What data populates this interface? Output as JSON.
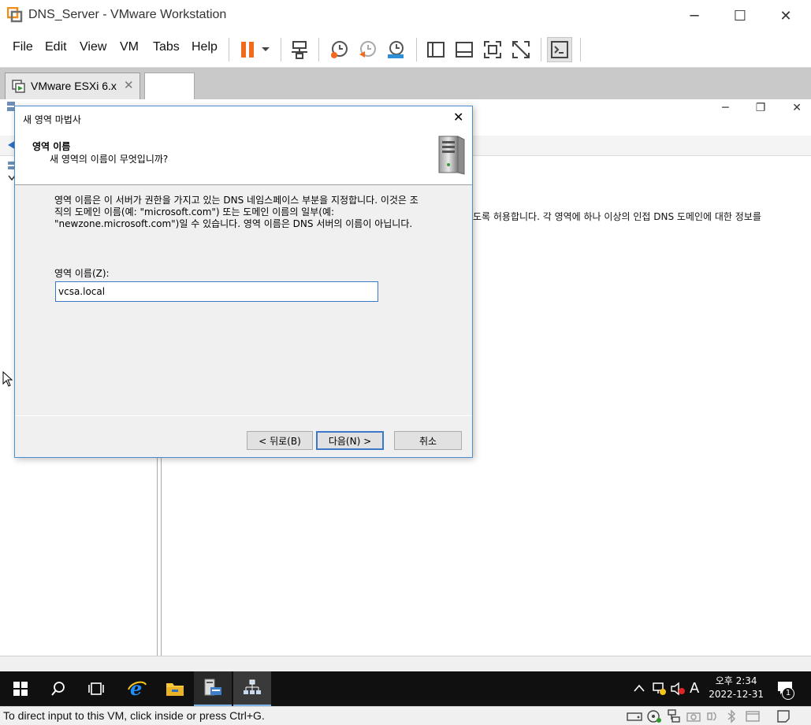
{
  "window": {
    "title": "DNS_Server - VMware Workstation",
    "min_glyph": "─",
    "max_glyph": "☐",
    "close_glyph": "✕"
  },
  "menu": {
    "items": [
      "File",
      "Edit",
      "View",
      "VM",
      "Tabs",
      "Help"
    ]
  },
  "tabs": {
    "esxi_label": "VMware ESXi 6.x",
    "close_glyph": "✕"
  },
  "background_app": {
    "min_glyph": "─",
    "restore_glyph": "❐",
    "close_glyph": "✕",
    "description": "도록 허용합니다. 각 영역에 하나 이상의 인접 DNS 도메인에 대한 정보를"
  },
  "dialog": {
    "title": "새 영역 마법사",
    "close_glyph": "✕",
    "heading": "영역 이름",
    "subheading": "새 영역의 이름이 무엇입니까?",
    "body_line1": "영역 이름은 이 서버가 권한을 가지고 있는 DNS 네임스페이스 부분을 지정합니다. 이것은 조",
    "body_line2": "직의 도메인 이름(예: \"microsoft.com\") 또는 도메인 이름의 일부(예:",
    "body_line3": "\"newzone.microsoft.com\")일 수 있습니다. 영역 이름은 DNS 서버의 이름이 아닙니다.",
    "zone_label": "영역 이름(Z):",
    "zone_value": "vcsa.local",
    "back_button": "< 뒤로(B)",
    "next_button": "다음(N) >",
    "cancel_button": "취소"
  },
  "taskbar": {
    "clock_time": "오후 2:34",
    "clock_date": "2022-12-31",
    "ime_label": "A",
    "notification_count": "1"
  },
  "statusbar": {
    "text": "To direct input to this VM, click inside or press Ctrl+G."
  },
  "colors": {
    "accent": "#3b78c8",
    "pause_orange": "#f26b1d",
    "taskbar": "#101010"
  }
}
